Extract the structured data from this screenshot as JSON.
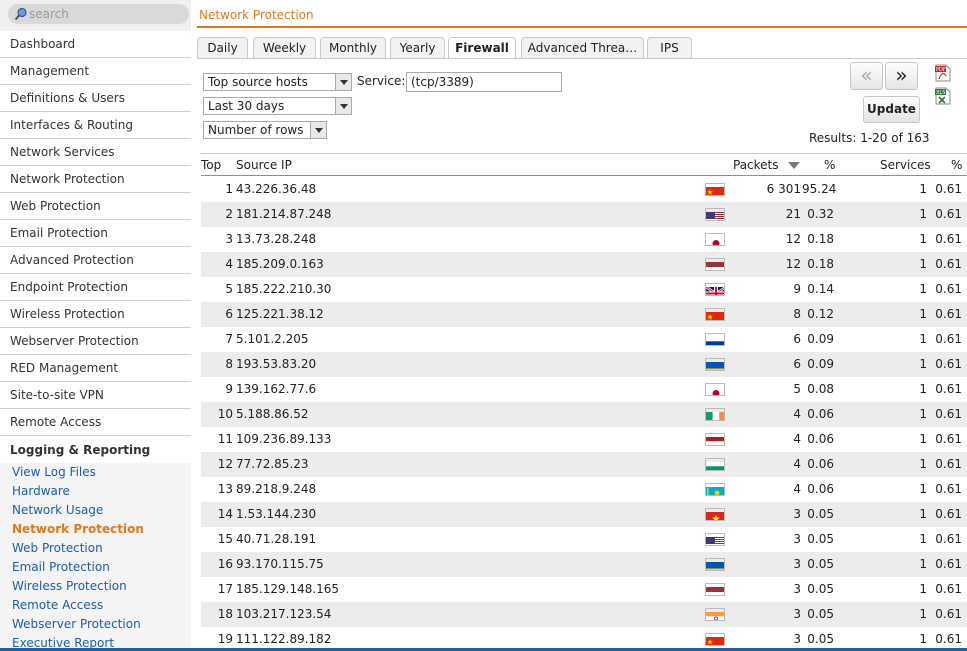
{
  "search": {
    "placeholder": "search"
  },
  "nav": {
    "items": [
      {
        "label": "Dashboard"
      },
      {
        "label": "Management"
      },
      {
        "label": "Definitions & Users"
      },
      {
        "label": "Interfaces & Routing"
      },
      {
        "label": "Network Services"
      },
      {
        "label": "Network Protection"
      },
      {
        "label": "Web Protection"
      },
      {
        "label": "Email Protection"
      },
      {
        "label": "Advanced Protection"
      },
      {
        "label": "Endpoint Protection"
      },
      {
        "label": "Wireless Protection"
      },
      {
        "label": "Webserver Protection"
      },
      {
        "label": "RED Management"
      },
      {
        "label": "Site-to-site VPN"
      },
      {
        "label": "Remote Access"
      }
    ],
    "section": "Logging & Reporting",
    "subitems": [
      {
        "label": "View Log Files"
      },
      {
        "label": "Hardware"
      },
      {
        "label": "Network Usage"
      },
      {
        "label": "Network Protection",
        "active": true
      },
      {
        "label": "Web Protection"
      },
      {
        "label": "Email Protection"
      },
      {
        "label": "Wireless Protection"
      },
      {
        "label": "Remote Access"
      },
      {
        "label": "Webserver Protection"
      },
      {
        "label": "Executive Report"
      }
    ]
  },
  "header": {
    "title": "Network Protection"
  },
  "tabs": [
    {
      "label": "Daily"
    },
    {
      "label": "Weekly"
    },
    {
      "label": "Monthly"
    },
    {
      "label": "Yearly"
    },
    {
      "label": "Firewall",
      "active": true
    },
    {
      "label": "Advanced Threa…"
    },
    {
      "label": "IPS"
    }
  ],
  "filters": {
    "report": "Top source hosts",
    "service_label": "Service:",
    "service_value": "(tcp/3389)",
    "range": "Last 30 days",
    "rows": "Number of rows"
  },
  "pager": {
    "prev": "«",
    "next": "»"
  },
  "update_label": "Update",
  "results": "Results: 1-20 of 163",
  "export": {
    "pdf_icon": "pdf-icon",
    "xls_icon": "xls-icon"
  },
  "table": {
    "headers": {
      "top": "Top",
      "source_ip": "Source IP",
      "packets": "Packets",
      "pct": "%",
      "services": "Services",
      "spct": "%"
    },
    "sort": "packets-desc",
    "rows": [
      {
        "rank": "1",
        "ip": "43.226.36.48",
        "flag": "cn",
        "packets": "6 301",
        "pct": "95.24",
        "services": "1",
        "spct": "0.61"
      },
      {
        "rank": "2",
        "ip": "181.214.87.248",
        "flag": "us",
        "packets": "21",
        "pct": "0.32",
        "services": "1",
        "spct": "0.61"
      },
      {
        "rank": "3",
        "ip": "13.73.28.248",
        "flag": "jp",
        "packets": "12",
        "pct": "0.18",
        "services": "1",
        "spct": "0.61"
      },
      {
        "rank": "4",
        "ip": "185.209.0.163",
        "flag": "lv",
        "packets": "12",
        "pct": "0.18",
        "services": "1",
        "spct": "0.61"
      },
      {
        "rank": "5",
        "ip": "185.222.210.30",
        "flag": "gb",
        "packets": "9",
        "pct": "0.14",
        "services": "1",
        "spct": "0.61"
      },
      {
        "rank": "6",
        "ip": "125.221.38.12",
        "flag": "cn",
        "packets": "8",
        "pct": "0.12",
        "services": "1",
        "spct": "0.61"
      },
      {
        "rank": "7",
        "ip": "5.101.2.205",
        "flag": "ru",
        "packets": "6",
        "pct": "0.09",
        "services": "1",
        "spct": "0.61"
      },
      {
        "rank": "8",
        "ip": "193.53.83.20",
        "flag": "ua",
        "packets": "6",
        "pct": "0.09",
        "services": "1",
        "spct": "0.61"
      },
      {
        "rank": "9",
        "ip": "139.162.77.6",
        "flag": "jp",
        "packets": "5",
        "pct": "0.08",
        "services": "1",
        "spct": "0.61"
      },
      {
        "rank": "10",
        "ip": "5.188.86.52",
        "flag": "ie",
        "packets": "4",
        "pct": "0.06",
        "services": "1",
        "spct": "0.61"
      },
      {
        "rank": "11",
        "ip": "109.236.89.133",
        "flag": "nl",
        "packets": "4",
        "pct": "0.06",
        "services": "1",
        "spct": "0.61"
      },
      {
        "rank": "12",
        "ip": "77.72.85.23",
        "flag": "bg",
        "packets": "4",
        "pct": "0.06",
        "services": "1",
        "spct": "0.61"
      },
      {
        "rank": "13",
        "ip": "89.218.9.248",
        "flag": "kz",
        "packets": "4",
        "pct": "0.06",
        "services": "1",
        "spct": "0.61"
      },
      {
        "rank": "14",
        "ip": "1.53.144.230",
        "flag": "vn",
        "packets": "3",
        "pct": "0.05",
        "services": "1",
        "spct": "0.61"
      },
      {
        "rank": "15",
        "ip": "40.71.28.191",
        "flag": "us",
        "packets": "3",
        "pct": "0.05",
        "services": "1",
        "spct": "0.61"
      },
      {
        "rank": "16",
        "ip": "93.170.115.75",
        "flag": "ua",
        "packets": "3",
        "pct": "0.05",
        "services": "1",
        "spct": "0.61"
      },
      {
        "rank": "17",
        "ip": "185.129.148.165",
        "flag": "lv",
        "packets": "3",
        "pct": "0.05",
        "services": "1",
        "spct": "0.61"
      },
      {
        "rank": "18",
        "ip": "103.217.123.54",
        "flag": "in",
        "packets": "3",
        "pct": "0.05",
        "services": "1",
        "spct": "0.61"
      },
      {
        "rank": "19",
        "ip": "111.122.89.182",
        "flag": "cn",
        "packets": "3",
        "pct": "0.05",
        "services": "1",
        "spct": "0.61"
      }
    ]
  },
  "colors": {
    "accent": "#e07a1f",
    "link": "#1d5fa8",
    "row_alt": "#ececec"
  }
}
